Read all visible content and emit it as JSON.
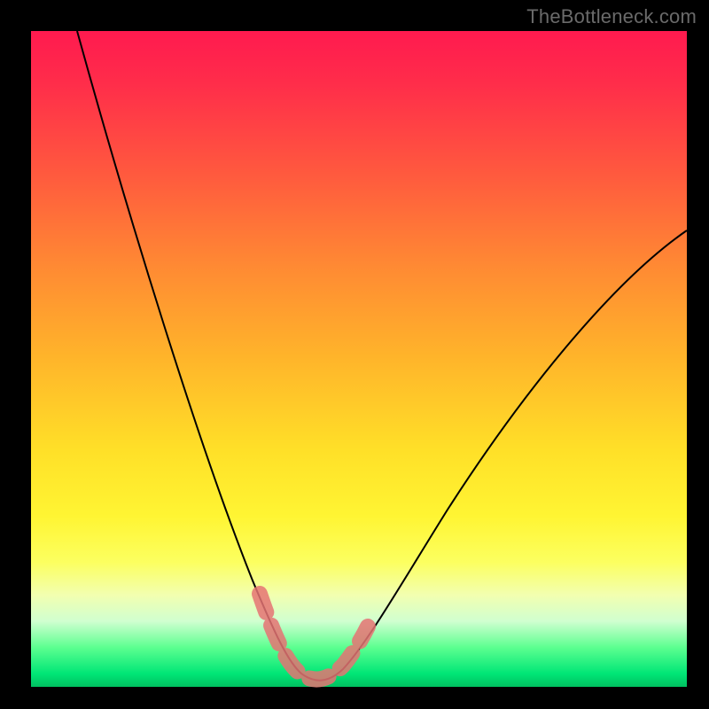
{
  "watermark": "TheBottleneck.com",
  "colors": {
    "frame": "#000000",
    "curve": "#000000",
    "dotStroke": "#e57373",
    "gradient_top": "#ff1a4f",
    "gradient_bottom": "#00c060"
  },
  "chart_data": {
    "type": "line",
    "title": "",
    "xlabel": "",
    "ylabel": "",
    "xlim": [
      0,
      100
    ],
    "ylim": [
      0,
      100
    ],
    "x": [
      0,
      5,
      10,
      15,
      20,
      25,
      30,
      33,
      36,
      38,
      40,
      42,
      45,
      50,
      55,
      60,
      65,
      70,
      75,
      80,
      85,
      90,
      95,
      100
    ],
    "values": [
      100,
      89,
      77,
      65,
      53,
      41,
      28,
      18,
      10,
      5,
      2,
      1,
      2,
      6,
      12,
      19,
      26,
      33,
      40,
      46,
      52,
      57,
      62,
      66
    ],
    "highlight_x_range": [
      33,
      47
    ],
    "annotations": []
  }
}
